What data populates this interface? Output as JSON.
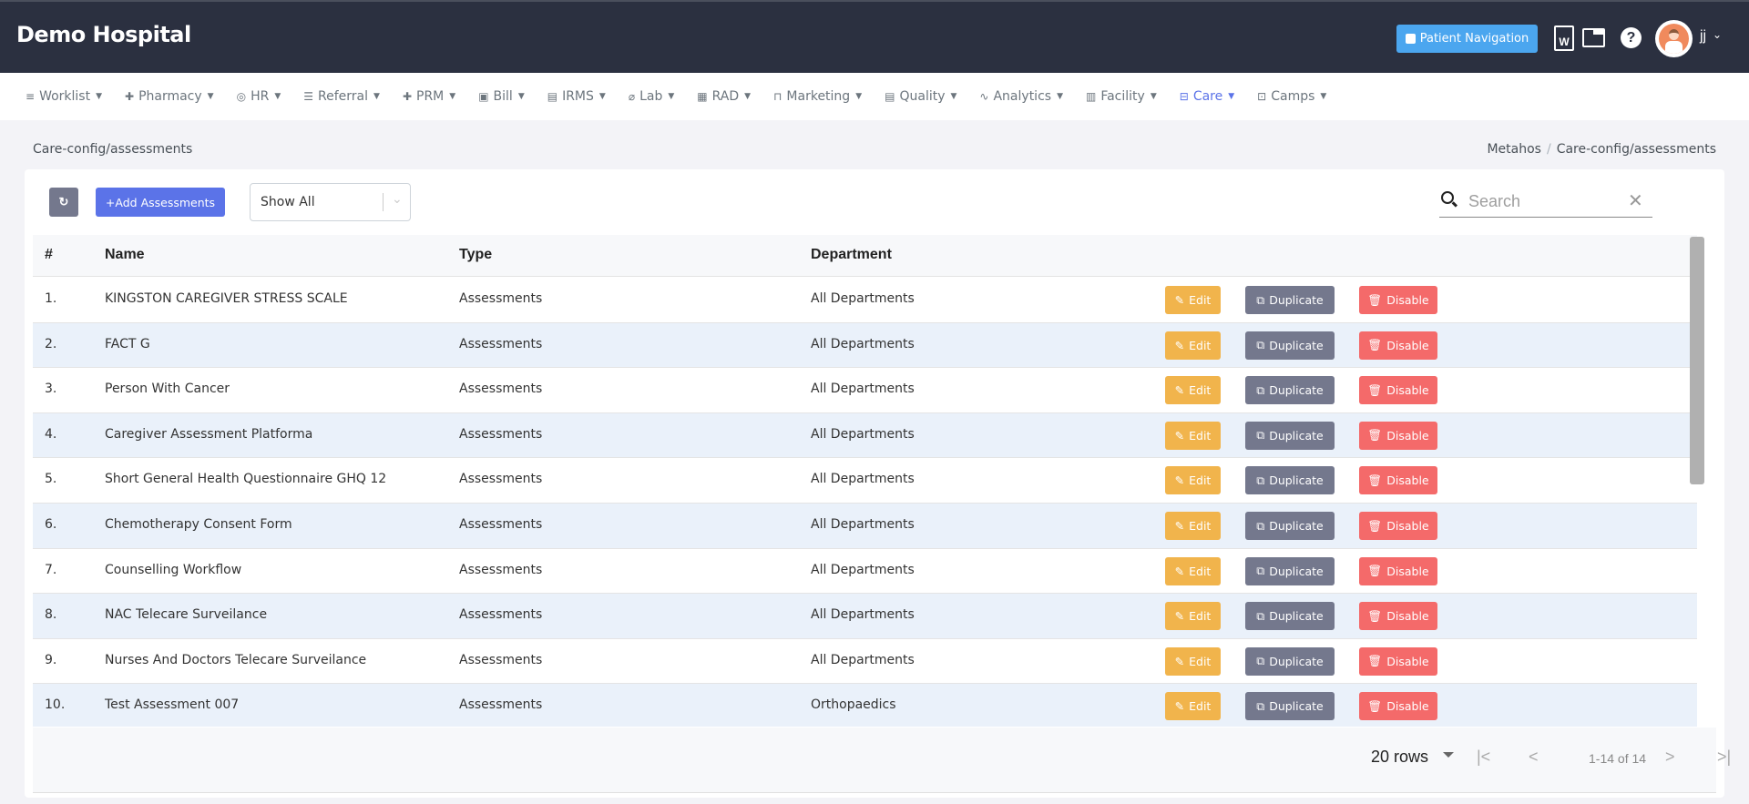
{
  "header": {
    "brand": "Demo Hospital",
    "patient_navigation_label": "Patient Navigation",
    "doc_icon_letter": "W",
    "help_glyph": "?",
    "user_name": "jj"
  },
  "nav": {
    "items": [
      {
        "label": "Worklist",
        "icon": "≡"
      },
      {
        "label": "Pharmacy",
        "icon": "✚"
      },
      {
        "label": "HR",
        "icon": "◎"
      },
      {
        "label": "Referral",
        "icon": "☰"
      },
      {
        "label": "PRM",
        "icon": "✚"
      },
      {
        "label": "Bill",
        "icon": "▣"
      },
      {
        "label": "IRMS",
        "icon": "▤"
      },
      {
        "label": "Lab",
        "icon": "⌀"
      },
      {
        "label": "RAD",
        "icon": "▦"
      },
      {
        "label": "Marketing",
        "icon": "⊓"
      },
      {
        "label": "Quality",
        "icon": "▤"
      },
      {
        "label": "Analytics",
        "icon": "∿"
      },
      {
        "label": "Facility",
        "icon": "▥"
      },
      {
        "label": "Care",
        "icon": "⊟",
        "active": true
      },
      {
        "label": "Camps",
        "icon": "⊡"
      }
    ]
  },
  "page": {
    "title": "Care-config/assessments",
    "breadcrumb": [
      "Metahos",
      "Care-config/assessments"
    ],
    "breadcrumb_sep": "/"
  },
  "toolbar": {
    "refresh_glyph": "↻",
    "add_label": "+Add Assessments",
    "filter_value": "Show All",
    "search_placeholder": "Search",
    "search_value": "",
    "clear_glyph": "✕"
  },
  "table": {
    "columns": [
      "#",
      "Name",
      "Type",
      "Department"
    ],
    "actions": {
      "edit": "Edit",
      "duplicate": "Duplicate",
      "disable": "Disable"
    },
    "rows": [
      {
        "index": "1.",
        "name": "KINGSTON CAREGIVER STRESS SCALE",
        "type": "Assessments",
        "department": "All Departments"
      },
      {
        "index": "2.",
        "name": "FACT G",
        "type": "Assessments",
        "department": "All Departments"
      },
      {
        "index": "3.",
        "name": "Person With Cancer",
        "type": "Assessments",
        "department": "All Departments"
      },
      {
        "index": "4.",
        "name": "Caregiver Assessment Platforma",
        "type": "Assessments",
        "department": "All Departments"
      },
      {
        "index": "5.",
        "name": "Short General Health Questionnaire GHQ 12",
        "type": "Assessments",
        "department": "All Departments"
      },
      {
        "index": "6.",
        "name": "Chemotherapy Consent Form",
        "type": "Assessments",
        "department": "All Departments"
      },
      {
        "index": "7.",
        "name": "Counselling Workflow",
        "type": "Assessments",
        "department": "All Departments"
      },
      {
        "index": "8.",
        "name": "NAC Telecare Surveilance",
        "type": "Assessments",
        "department": "All Departments"
      },
      {
        "index": "9.",
        "name": "Nurses And Doctors Telecare Surveilance",
        "type": "Assessments",
        "department": "All Departments"
      },
      {
        "index": "10.",
        "name": "Test Assessment 007",
        "type": "Assessments",
        "department": "Orthopaedics"
      }
    ]
  },
  "pagination": {
    "rows_per_page": "20 rows",
    "range": "1-14 of 14",
    "first": "|<",
    "prev": "<",
    "next": ">",
    "last": ">|"
  }
}
